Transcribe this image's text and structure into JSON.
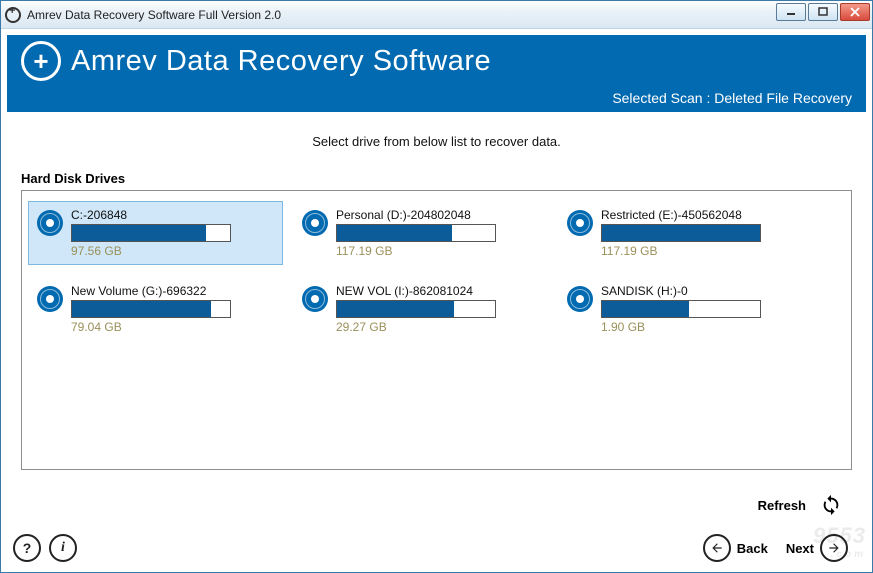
{
  "window_title": "Amrev Data Recovery Software Full Version 2.0",
  "app_name": "Amrev Data Recovery Software",
  "selected_scan_text": "Selected Scan : Deleted File Recovery",
  "instructions": "Select drive from below list to recover data.",
  "section_label": "Hard Disk Drives",
  "drives": [
    {
      "label": "C:-206848",
      "size": "97.56 GB",
      "fill": 85,
      "selected": true
    },
    {
      "label": "Personal (D:)-204802048",
      "size": "117.19 GB",
      "fill": 73,
      "selected": false
    },
    {
      "label": "Restricted (E:)-450562048",
      "size": "117.19 GB",
      "fill": 100,
      "selected": false
    },
    {
      "label": "New Volume (G:)-696322",
      "size": "79.04 GB",
      "fill": 88,
      "selected": false
    },
    {
      "label": "NEW VOL (I:)-862081024",
      "size": "29.27 GB",
      "fill": 74,
      "selected": false
    },
    {
      "label": "SANDISK (H:)-0",
      "size": "1.90 GB",
      "fill": 55,
      "selected": false
    }
  ],
  "buttons": {
    "refresh": "Refresh",
    "back": "Back",
    "next": "Next"
  },
  "watermark": {
    "main": "9553",
    "sub": ".com"
  }
}
